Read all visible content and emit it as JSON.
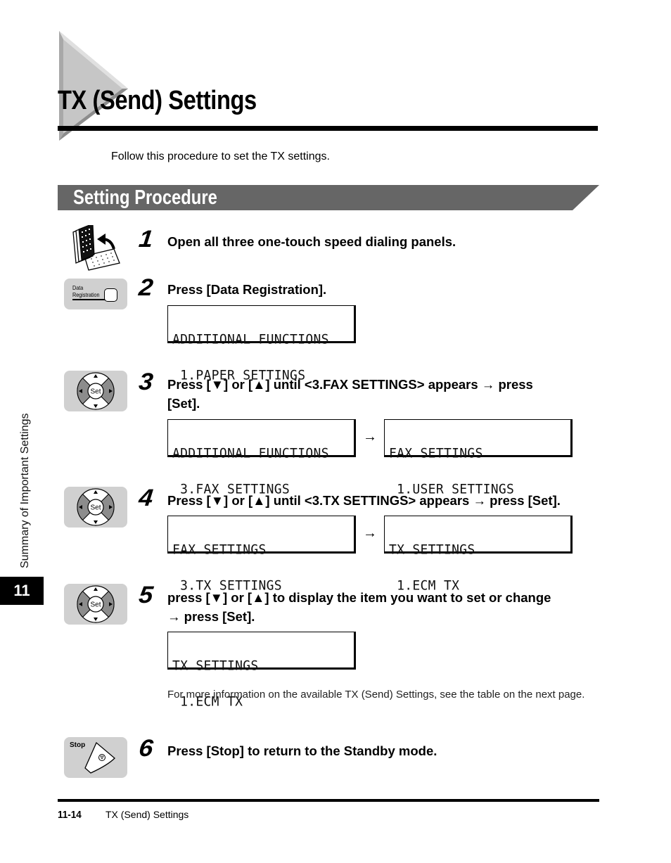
{
  "page": {
    "title": "TX (Send) Settings",
    "intro": "Follow this procedure to set the TX settings.",
    "section_title": "Setting Procedure"
  },
  "side": {
    "chapter_label": "Summary of Important Settings",
    "chapter_number": "11"
  },
  "steps": [
    {
      "number": "1",
      "icon": "one-touch-panel-icon",
      "text": "Open all three one-touch speed dialing panels."
    },
    {
      "number": "2",
      "icon": "data-registration-key-icon",
      "icon_label_line1": "Data",
      "icon_label_line2": "Registration",
      "text": "Press [Data Registration].",
      "displays": [
        {
          "line1": "ADDITIONAL FUNCTIONS",
          "line2": " 1.PAPER SETTINGS"
        }
      ]
    },
    {
      "number": "3",
      "icon": "set-navigation-keys-icon",
      "icon_label": "Set",
      "text_line1": "Press [▼] or [▲] until <3.FAX SETTINGS> appears → press",
      "text_line2": "[Set].",
      "displays": [
        {
          "line1": "ADDITIONAL FUNCTIONS",
          "line2": " 3.FAX SETTINGS"
        },
        {
          "line1": "FAX SETTINGS",
          "line2": " 1.USER SETTINGS"
        }
      ],
      "arrow": "→"
    },
    {
      "number": "4",
      "icon": "set-navigation-keys-icon",
      "icon_label": "Set",
      "text": "Press [▼] or [▲] until <3.TX SETTINGS> appears → press [Set].",
      "displays": [
        {
          "line1": "FAX SETTINGS",
          "line2": " 3.TX SETTINGS"
        },
        {
          "line1": "TX SETTINGS",
          "line2": " 1.ECM TX"
        }
      ],
      "arrow": "→"
    },
    {
      "number": "5",
      "icon": "set-navigation-keys-icon",
      "icon_label": "Set",
      "text_line1": "press [▼] or [▲] to display the item you want to set or change",
      "text_line2": "→ press [Set].",
      "displays": [
        {
          "line1": "TX SETTINGS",
          "line2": " 1.ECM TX"
        }
      ],
      "note": "For more information on the available TX (Send) Settings, see the table on the next page."
    },
    {
      "number": "6",
      "icon": "stop-key-icon",
      "icon_label": "Stop",
      "text": "Press [Stop] to return to the Standby mode."
    }
  ],
  "footer": {
    "page_number": "11-14",
    "title": "TX (Send) Settings"
  },
  "colors": {
    "section_bar": "#666666",
    "icon_background": "#d0d0d0",
    "dpad_dark": "#8c8c8c",
    "triangle_light": "#c4c4c4",
    "triangle_dark": "#8a8a8a"
  }
}
